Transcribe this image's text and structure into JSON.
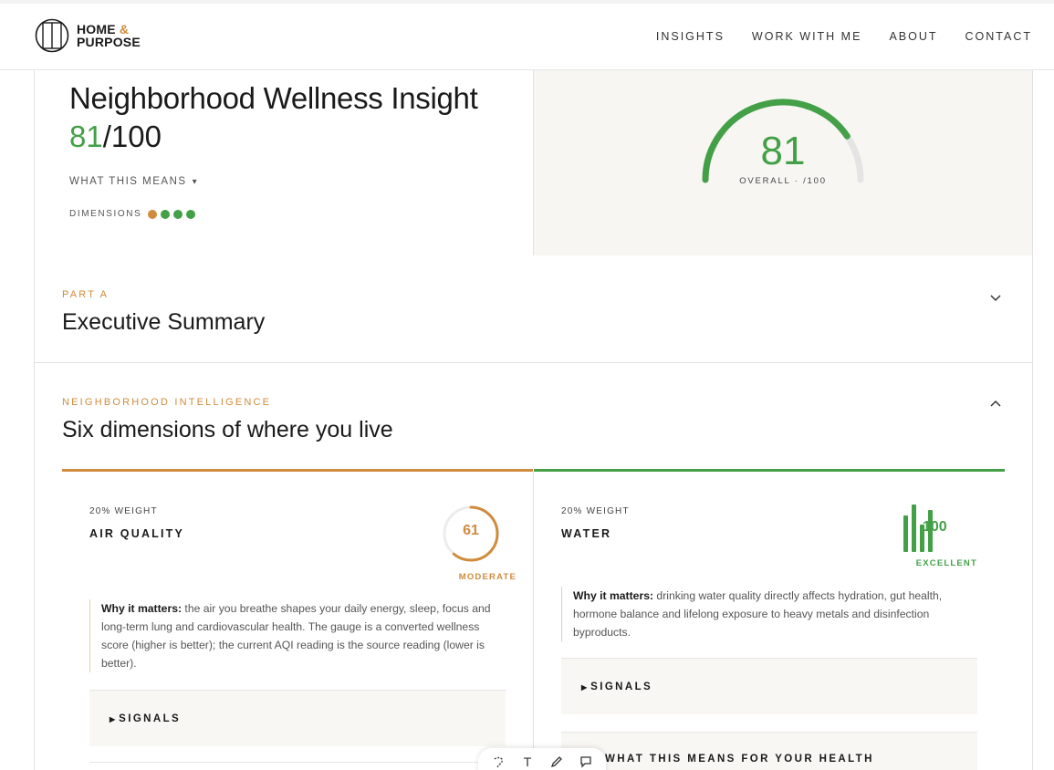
{
  "brand": {
    "line1": "HOME",
    "amp": "&",
    "line2": "PURPOSE",
    "accent_color": "#d08b3c"
  },
  "nav": {
    "items": [
      "INSIGHTS",
      "WORK WITH ME",
      "ABOUT",
      "CONTACT"
    ]
  },
  "hero": {
    "title": "Neighborhood Wellness Insight",
    "score_value": "81",
    "score_suffix": "/100",
    "what_means": "WHAT THIS MEANS",
    "dimensions_label": "DIMENSIONS",
    "dimension_dots": [
      "#d08b3c",
      "#43a047",
      "#43a047",
      "#43a047"
    ],
    "gauge": {
      "value": "81",
      "label": "OVERALL · /100",
      "fraction": 0.81,
      "color": "#43a047"
    }
  },
  "sections": {
    "part_a": {
      "eyebrow": "PART A",
      "title": "Executive Summary",
      "state": "collapsed"
    },
    "intelligence": {
      "eyebrow": "NEIGHBORHOOD INTELLIGENCE",
      "title": "Six dimensions of where you live",
      "state": "expanded"
    }
  },
  "dimensions": [
    {
      "weight": "20% WEIGHT",
      "name": "AIR QUALITY",
      "score": "61",
      "score_fraction": 0.61,
      "status": "MODERATE",
      "color": "#d08b3c",
      "why_label": "Why it matters:",
      "why_text": " the air you breathe shapes your daily energy, sleep, focus and long-term lung and cardiovascular health. The gauge is a converted wellness score (higher is better); the current AQI reading is the source reading (lower is better).",
      "signals_label": "SIGNALS"
    },
    {
      "weight": "20% WEIGHT",
      "name": "WATER",
      "score": "100",
      "status": "EXCELLENT",
      "color": "#43a047",
      "why_label": "Why it matters:",
      "why_text": " drinking water quality directly affects hydration, gut health, hormone balance and lifelong exposure to heavy metals and disinfection byproducts.",
      "signals_label": "SIGNALS",
      "health_label": "WHAT THIS MEANS FOR YOUR HEALTH"
    }
  ],
  "toolbar": {
    "icons": [
      "lasso-icon",
      "text-icon",
      "pen-icon",
      "comment-icon"
    ],
    "text_glyph": "T"
  }
}
